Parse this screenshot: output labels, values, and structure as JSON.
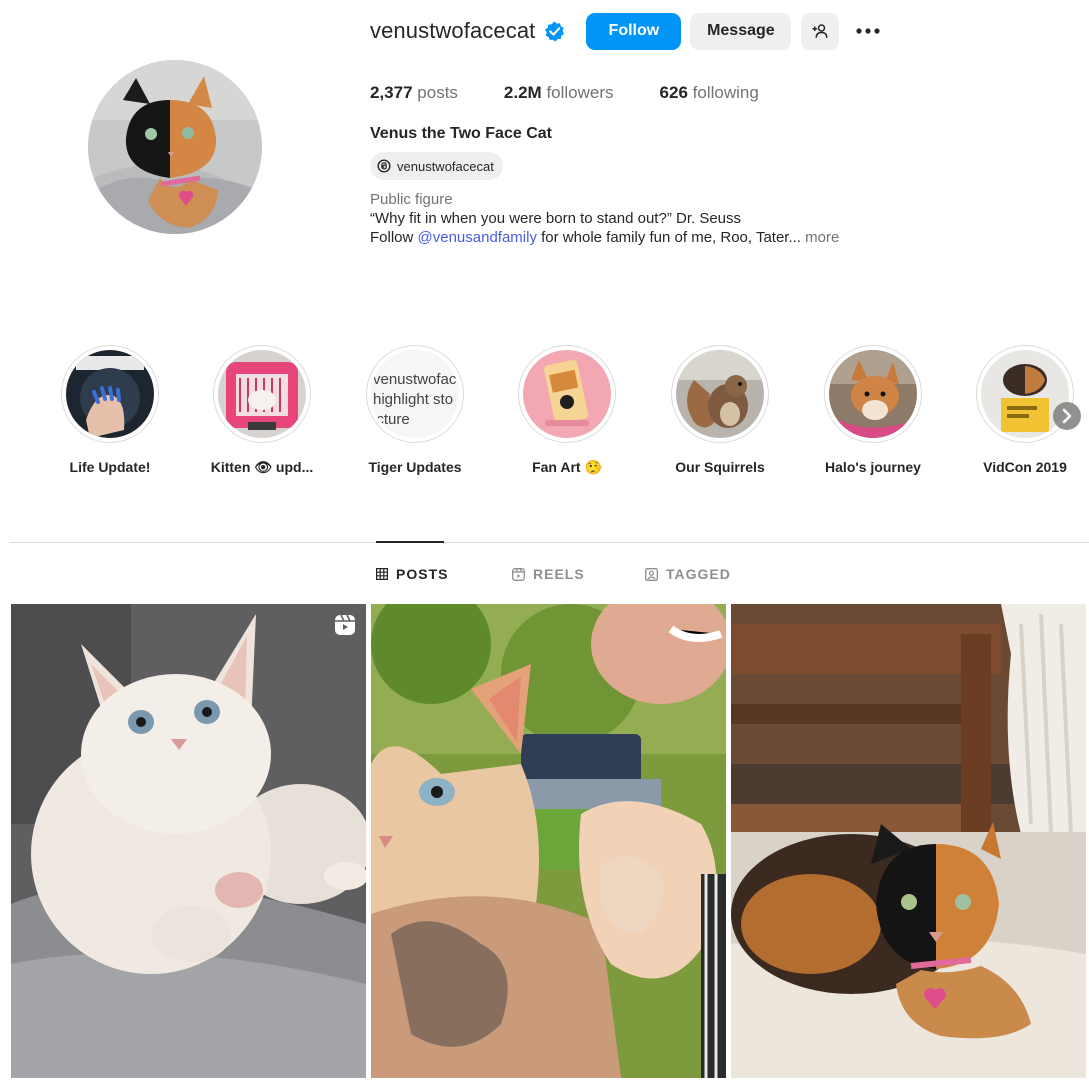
{
  "profile": {
    "username": "venustwofacecat",
    "follow_label": "Follow",
    "message_label": "Message",
    "stats": [
      {
        "value": "2,377",
        "label": "posts"
      },
      {
        "value": "2.2M",
        "label": "followers"
      },
      {
        "value": "626",
        "label": "following"
      }
    ],
    "full_name": "Venus the Two Face Cat",
    "threads_handle": "venustwofacecat",
    "category": "Public figure",
    "bio_line1": "“Why fit in when you were born to stand out?” Dr. Seuss",
    "bio_line2_prefix": "Follow ",
    "bio_mention": "@venusandfamily",
    "bio_line2_suffix": " for whole family fun of me, Roo, Tater...",
    "more_label": " more"
  },
  "highlights": [
    {
      "label": "Life Update!"
    },
    {
      "label": "Kitten 👁 upd..."
    },
    {
      "label": "Tiger Updates",
      "placeholder_text": "venustwofac highlight sto icture"
    },
    {
      "label": "Fan Art 🤥"
    },
    {
      "label": "Our Squirrels"
    },
    {
      "label": "Halo's journey"
    },
    {
      "label": "VidCon 2019"
    }
  ],
  "tabs": [
    {
      "label": "POSTS",
      "active": true
    },
    {
      "label": "REELS",
      "active": false
    },
    {
      "label": "TAGGED",
      "active": false
    }
  ],
  "colors": {
    "accent": "#0095f6",
    "verified": "#0095f6",
    "link": "#4a5de0",
    "muted": "#737373"
  },
  "icons": [
    "verified-badge-icon",
    "add-user-icon",
    "more-icon",
    "threads-icon",
    "grid-icon",
    "reels-icon",
    "tagged-icon",
    "reel-badge-icon",
    "chevron-right-icon"
  ]
}
